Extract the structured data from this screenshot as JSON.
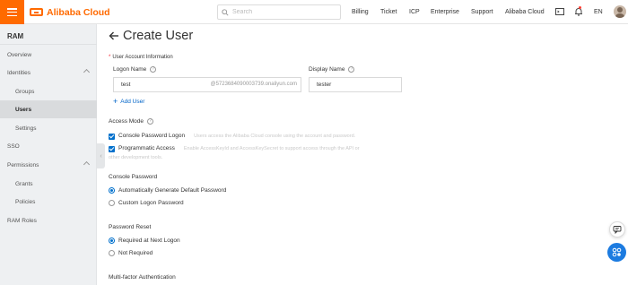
{
  "topbar": {
    "brand": "Alibaba Cloud",
    "search_placeholder": "Search",
    "nav": [
      "Billing",
      "Ticket",
      "ICP",
      "Enterprise",
      "Support",
      "Alibaba Cloud"
    ],
    "lang": "EN",
    "brand_color": "#ff6a00"
  },
  "sidebar": {
    "title": "RAM",
    "items": [
      {
        "label": "Overview"
      },
      {
        "label": "Identities"
      },
      {
        "label": "Groups"
      },
      {
        "label": "Users"
      },
      {
        "label": "Settings"
      },
      {
        "label": "SSO"
      },
      {
        "label": "Permissions"
      },
      {
        "label": "Grants"
      },
      {
        "label": "Policies"
      },
      {
        "label": "RAM Roles"
      }
    ]
  },
  "main": {
    "title": "Create User",
    "account_section": "User Account Information",
    "logon_name_label": "Logon Name",
    "display_name_label": "Display Name",
    "logon_name_value": "test",
    "logon_suffix": "@5723684090003739.onaliyun.com",
    "display_name_value": "tester",
    "add_user": "Add User",
    "access_mode_label": "Access Mode",
    "console_logon_label": "Console Password Logon",
    "console_logon_desc": "Users access the Alibaba Cloud console using the account and password.",
    "programmatic_label": "Programmatic Access",
    "programmatic_desc": "Enable AccessKeyId and AccessKeySecret to support access through the API or",
    "programmatic_desc2": "other development tools.",
    "console_password_label": "Console Password",
    "auto_password": "Automatically Generate Default Password",
    "custom_password": "Custom Logon Password",
    "password_reset_label": "Password Reset",
    "required_next": "Required at Next Logon",
    "not_required": "Not Required",
    "mfa_label": "Multi-factor Authentication"
  }
}
